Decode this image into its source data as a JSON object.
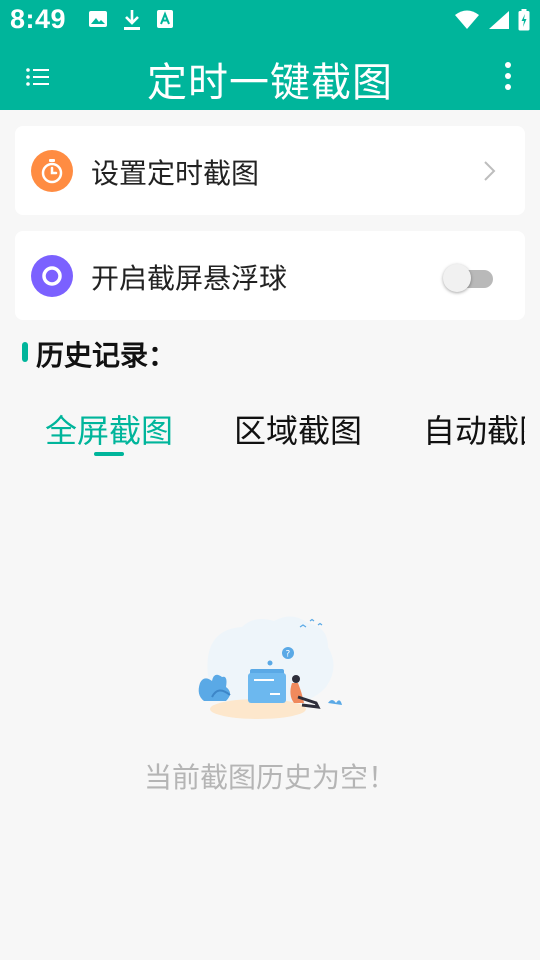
{
  "status_bar": {
    "time": "8:49",
    "left_icons": [
      "image-icon",
      "download-icon",
      "text-a-icon"
    ],
    "right_icons": [
      "wifi-icon",
      "signal-icon",
      "battery-icon"
    ]
  },
  "app_bar": {
    "title": "定时一键截图",
    "menu_icon": "list-menu-icon",
    "more_icon": "more-vert-icon"
  },
  "cards": [
    {
      "label": "设置定时截图",
      "icon": "timer-icon",
      "icon_color": "#ff8c42",
      "trailing": "chevron-right"
    },
    {
      "label": "开启截屏悬浮球",
      "icon": "target-icon",
      "icon_color": "#7b61ff",
      "trailing": "toggle",
      "toggle_on": false
    }
  ],
  "history": {
    "title": "历史记录：",
    "tabs": [
      "全屏截图",
      "区域截图",
      "自动截图"
    ],
    "active_tab": 0,
    "empty_text": "当前截图历史为空！"
  },
  "colors": {
    "primary": "#00b59b",
    "background": "#f7f7f7"
  }
}
